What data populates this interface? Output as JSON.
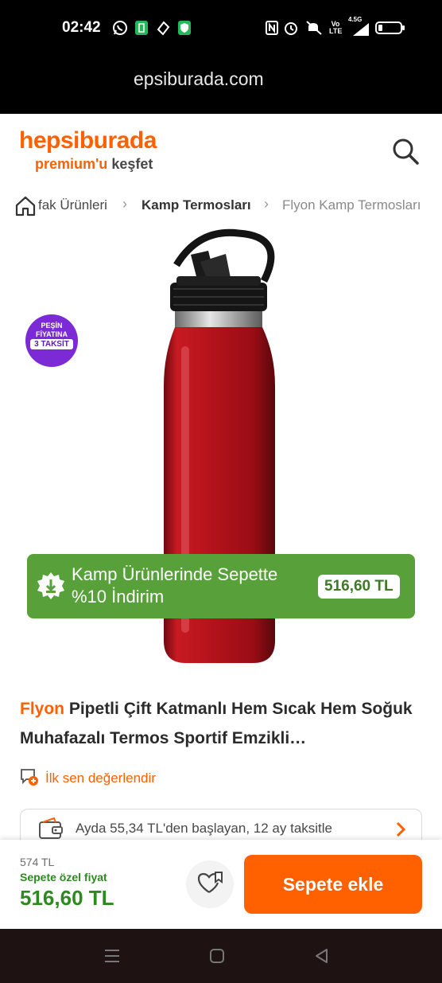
{
  "status_bar": {
    "time": "02:42",
    "icons": [
      "whatsapp-icon",
      "battery-saver-icon",
      "vpn-icon",
      "shield-icon",
      "nfc-icon",
      "alarm-icon",
      "mute-icon",
      "volte-icon",
      "signal-4-5g-icon",
      "battery-icon"
    ],
    "network_label": "4.5G",
    "volte_label": "Vo LTE"
  },
  "browser": {
    "url": "epsiburada.com",
    "close_icon": "close-icon",
    "collapse_icon": "chevron-down-icon",
    "share_icon": "share-icon",
    "menu_icon": "more-vertical-icon"
  },
  "header": {
    "logo": "hepsiburada",
    "tagline_highlight": "premium'u",
    "tagline_rest": "keşfet",
    "brand_color": "#ff6000"
  },
  "breadcrumb": {
    "items": [
      {
        "label": "fak Ürünleri",
        "bold": false
      },
      {
        "label": "Kamp Termosları",
        "bold": true
      },
      {
        "label": "Flyon Kamp Termosları",
        "bold": false
      }
    ]
  },
  "badge": {
    "line1": "PEŞİN",
    "line2": "FİYATINA",
    "line3": "3 TAKSİT"
  },
  "promo": {
    "text": "Kamp Ürünlerinde Sepette %10 İndirim",
    "price": "516,60 TL",
    "color": "#58a13a"
  },
  "product": {
    "brand": "Flyon",
    "name": "Pipetli Çift Katmanlı Hem Sıcak Hem Soğuk Muhafazalı Termos Sportif Emzikli…",
    "bottle_color": "#b3121b"
  },
  "rating": {
    "label": "İlk sen değerlendir"
  },
  "installment": {
    "text": "Ayda 55,34 TL'den başlayan, 12 ay taksitle"
  },
  "bottom_bar": {
    "old_price": "574 TL",
    "special_label": "Sepete özel fiyat",
    "special_price": "516,60 TL",
    "add_to_cart": "Sepete ekle"
  }
}
